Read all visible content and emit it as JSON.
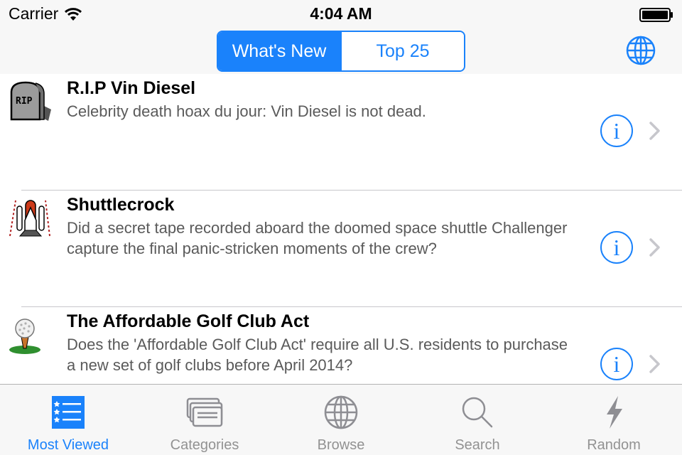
{
  "status_bar": {
    "carrier": "Carrier",
    "time": "4:04 AM"
  },
  "nav": {
    "segments": [
      {
        "label": "What's New",
        "selected": true
      },
      {
        "label": "Top 25",
        "selected": false
      }
    ],
    "right_icon": "globe-icon"
  },
  "list": {
    "items": [
      {
        "title": "R.I.P Vin Diesel",
        "description": "Celebrity death hoax du jour: Vin Diesel is not dead.",
        "icon": "tombstone-icon"
      },
      {
        "title": "Shuttlecrock",
        "description": "Did a secret tape recorded aboard the doomed space shuttle Challenger capture the final panic-stricken moments of the crew?",
        "icon": "space-shuttle-icon"
      },
      {
        "title": "The Affordable Golf Club Act",
        "description": "Does the 'Affordable Golf Club Act' require all U.S. residents to purchase a new set of golf clubs before April 2014?",
        "icon": "golf-ball-icon"
      }
    ],
    "info_glyph": "i"
  },
  "tab_bar": {
    "tabs": [
      {
        "label": "Most Viewed",
        "icon": "most-viewed-list-icon",
        "active": true
      },
      {
        "label": "Categories",
        "icon": "categories-icon",
        "active": false
      },
      {
        "label": "Browse",
        "icon": "globe-icon",
        "active": false
      },
      {
        "label": "Search",
        "icon": "magnifier-icon",
        "active": false
      },
      {
        "label": "Random",
        "icon": "lightning-icon",
        "active": false
      }
    ]
  },
  "colors": {
    "accent": "#1a82fb",
    "tab_inactive": "#929292",
    "bar_background": "#f7f7f7",
    "description_text": "#5a5a5a"
  }
}
